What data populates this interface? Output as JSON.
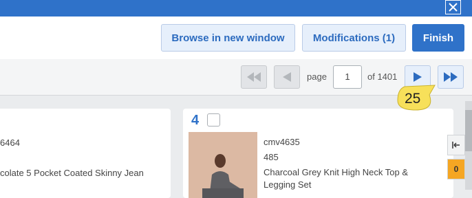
{
  "window": {
    "close_icon": "close-icon"
  },
  "toolbar": {
    "browse_label": "Browse in new window",
    "modifications_label": "Modifications (1)",
    "finish_label": "Finish"
  },
  "pager": {
    "page_label": "page",
    "page_value": "1",
    "of_label": "of 1401",
    "tooltip_value": "25"
  },
  "cards": [
    {
      "sku_partial": "6464",
      "title_partial": "colate 5 Pocket Coated Skinny Jean"
    },
    {
      "index": "4",
      "sku": "cmv4635",
      "qty": "485",
      "title_line1": "Charcoal Grey Knit High Neck Top &",
      "title_line2": "Legging Set"
    }
  ],
  "side": {
    "collapse_icon": "collapse-left-icon",
    "badge": "0"
  },
  "colors": {
    "brand": "#2f72c9",
    "accent": "#f7e05a",
    "badge": "#f5a623"
  }
}
